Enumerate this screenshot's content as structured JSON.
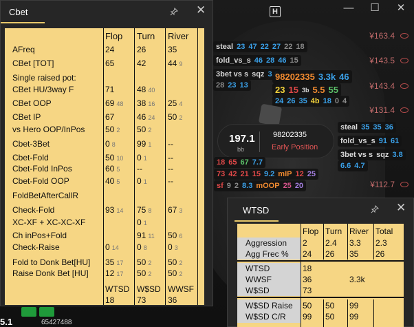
{
  "window": {
    "controls": [
      "—",
      "☐",
      "✕"
    ]
  },
  "stacks": [
    "¥163.4",
    "¥143.5",
    "¥143.4",
    "¥131.4",
    "¥112.7"
  ],
  "hud_top": {
    "r1": [
      "steal",
      "23",
      "47",
      "22",
      "27",
      "22",
      "18"
    ],
    "r2": [
      "fold_vs_s",
      "46",
      "28",
      "46",
      "15"
    ],
    "r3": [
      "3bet vs s",
      "sqz",
      "3.6"
    ],
    "r4": [
      "28",
      "23",
      "13"
    ]
  },
  "hud_player": {
    "name": "98202335",
    "r1": [
      "3.3k",
      "46"
    ],
    "r2": [
      "23",
      "15",
      "3b",
      "5.5",
      "55"
    ],
    "r3": [
      "24",
      "26",
      "35",
      "4b",
      "18",
      "0",
      "4"
    ]
  },
  "hero": {
    "stack": "197.1",
    "unit": "bb",
    "name": "98202335",
    "position": "Early Position"
  },
  "hud_right": {
    "r1": [
      "steal",
      "35",
      "35",
      "36"
    ],
    "r2": [
      "fold_vs_s",
      "91",
      "61"
    ],
    "r3": [
      "3bet vs s",
      "sqz",
      "3.8"
    ],
    "r4": [
      "6.6",
      "4.7"
    ]
  },
  "hud_mid": {
    "r1": [
      "18",
      "65",
      "67",
      "7.7"
    ],
    "r2": [
      "73",
      "42",
      "21",
      "15",
      "9.2",
      "mIP",
      "12",
      "25"
    ],
    "r3": [
      "sf",
      "9",
      "2",
      "8.3",
      "mOOP",
      "25",
      "20"
    ]
  },
  "bottom": {
    "num": "5.1",
    "name": "65427488"
  },
  "cbet": {
    "title": "Cbet",
    "headers": [
      "Flop",
      "Turn",
      "River"
    ],
    "rows": [
      {
        "label": "AFreq",
        "flop": "24",
        "flop_s": "",
        "turn": "26",
        "turn_s": "",
        "river": "35",
        "river_s": ""
      },
      {
        "label": "CBet [TOT]",
        "flop": "65",
        "flop_s": "",
        "turn": "42",
        "turn_s": "",
        "river": "44",
        "river_s": "9"
      },
      {
        "label": "Single raised pot:",
        "flop": "",
        "flop_s": "",
        "turn": "",
        "turn_s": "",
        "river": "",
        "river_s": ""
      },
      {
        "label": "CBet HU/3way F",
        "flop": "71",
        "flop_s": "",
        "turn": "48",
        "turn_s": "40",
        "river": "",
        "river_s": ""
      },
      {
        "label": "CBet OOP",
        "flop": "69",
        "flop_s": "48",
        "turn": "38",
        "turn_s": "16",
        "river": "25",
        "river_s": "4"
      },
      {
        "label": "CBet IP",
        "flop": "67",
        "flop_s": "",
        "turn": "46",
        "turn_s": "24",
        "river": "50",
        "river_s": "2"
      },
      {
        "label": "vs Hero OOP/InPos",
        "flop": "50",
        "flop_s": "2",
        "turn": "50",
        "turn_s": "2",
        "river": "",
        "river_s": ""
      },
      {
        "label": "Cbet-3Bet",
        "flop": "0",
        "flop_s": "8",
        "turn": "99",
        "turn_s": "1",
        "river": "--",
        "river_s": ""
      },
      {
        "label": "Cbet-Fold",
        "flop": "50",
        "flop_s": "10",
        "turn": "0",
        "turn_s": "1",
        "river": "--",
        "river_s": ""
      },
      {
        "label": "Cbet-Fold InPos",
        "flop": "60",
        "flop_s": "5",
        "turn": "--",
        "turn_s": "",
        "river": "--",
        "river_s": ""
      },
      {
        "label": "Cbet-Fold OOP",
        "flop": "40",
        "flop_s": "5",
        "turn": "0",
        "turn_s": "1",
        "river": "--",
        "river_s": ""
      },
      {
        "label": "FoldBetAfterCallR",
        "flop": "",
        "flop_s": "",
        "turn": "",
        "turn_s": "",
        "river": "",
        "river_s": ""
      },
      {
        "label": "Check-Fold",
        "flop": "93",
        "flop_s": "14",
        "turn": "75",
        "turn_s": "8",
        "river": "67",
        "river_s": "3"
      },
      {
        "label": "XC-XF + XC-XC-XF",
        "flop": "",
        "flop_s": "",
        "turn": "0",
        "turn_s": "1",
        "river": "",
        "river_s": ""
      },
      {
        "label": "Ch inPos+Fold",
        "flop": "",
        "flop_s": "",
        "turn": "91",
        "turn_s": "11",
        "river": "50",
        "river_s": "6"
      },
      {
        "label": "Check-Raise",
        "flop": "0",
        "flop_s": "14",
        "turn": "0",
        "turn_s": "8",
        "river": "0",
        "river_s": "3"
      },
      {
        "label": "Fold to Donk Bet[HU]",
        "flop": "35",
        "flop_s": "17",
        "turn": "50",
        "turn_s": "2",
        "river": "50",
        "river_s": "2"
      },
      {
        "label": "Raise Donk Bet [HU]",
        "flop": "12",
        "flop_s": "17",
        "turn": "50",
        "turn_s": "2",
        "river": "50",
        "river_s": "2"
      }
    ],
    "footer_labels": [
      "WTSD",
      "W$SD",
      "WWSF"
    ],
    "footer_values": [
      "18",
      "73",
      "36"
    ]
  },
  "wtsd": {
    "title": "WTSD",
    "headers": [
      "Flop",
      "Turn",
      "River",
      "Total"
    ],
    "aggression": {
      "label": "Aggression",
      "values": [
        "2",
        "2.4",
        "3.3",
        "2.3"
      ]
    },
    "aggfrec": {
      "label": "Agg Frec %",
      "values": [
        "24",
        "26",
        "35",
        "26"
      ]
    },
    "showdown": [
      {
        "label": "WTSD",
        "value": "18"
      },
      {
        "label": "WWSF",
        "value": "36"
      },
      {
        "label": "W$SD",
        "value": "73"
      }
    ],
    "hands": "3.3k",
    "wsd_raise": {
      "label": "W$SD Raise",
      "values": [
        "50",
        "50",
        "99"
      ]
    },
    "wsd_cr": {
      "label": "W$SD C/R",
      "values": [
        "99",
        "50",
        "99"
      ]
    }
  }
}
